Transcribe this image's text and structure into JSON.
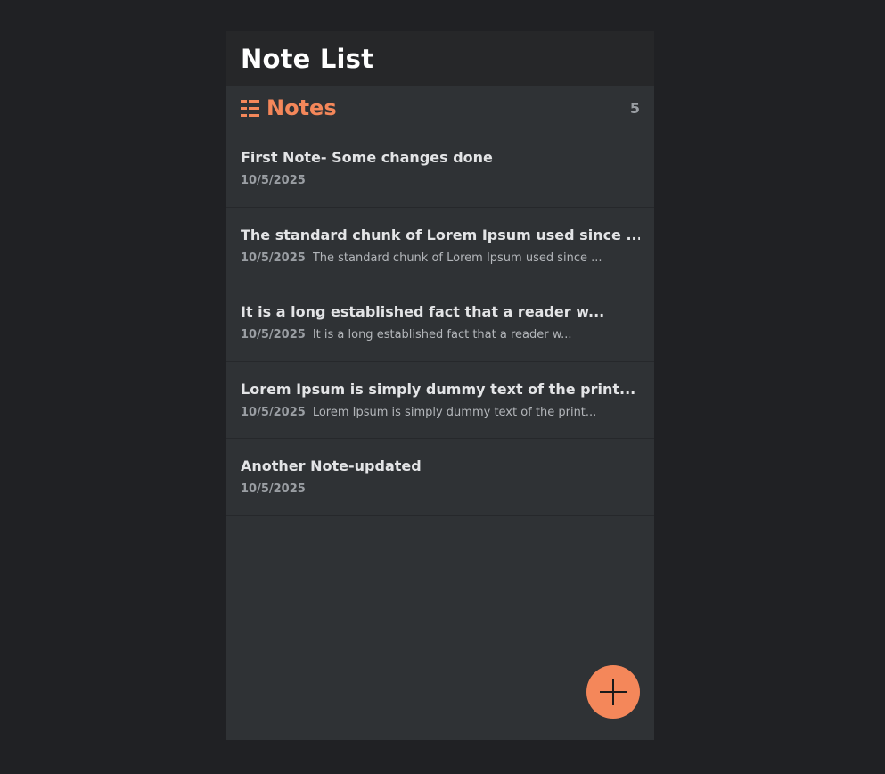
{
  "header": {
    "title": "Note List"
  },
  "notes_section": {
    "label": "Notes",
    "count": "5",
    "icon": "list-icon"
  },
  "notes": [
    {
      "title": "First Note- Some changes done",
      "date": "10/5/2025",
      "preview": ""
    },
    {
      "title": "The standard chunk of Lorem Ipsum used since ...",
      "date": "10/5/2025",
      "preview": "The standard chunk of Lorem Ipsum used since ..."
    },
    {
      "title": "It is a long established fact that a reader w...",
      "date": "10/5/2025",
      "preview": "It is a long established fact that a reader w..."
    },
    {
      "title": "Lorem Ipsum is simply dummy text of the print...",
      "date": "10/5/2025",
      "preview": "Lorem Ipsum is simply dummy text of the print..."
    },
    {
      "title": "Another Note-updated",
      "date": "10/5/2025",
      "preview": ""
    }
  ],
  "fab": {
    "icon": "plus-icon"
  },
  "colors": {
    "accent": "#f4875a",
    "page_background": "#202124",
    "panel_background": "#2f3235",
    "header_background": "#262729"
  }
}
